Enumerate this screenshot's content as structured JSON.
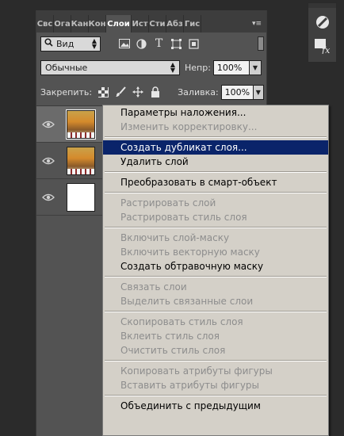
{
  "panel": {
    "tabs": [
      {
        "label": "Свс",
        "active": false
      },
      {
        "label": "Ога",
        "active": false
      },
      {
        "label": "Кан",
        "active": false
      },
      {
        "label": "Кон",
        "active": false
      },
      {
        "label": "Слои",
        "active": true
      },
      {
        "label": "Ист",
        "active": false
      },
      {
        "label": "Сти",
        "active": false
      },
      {
        "label": "Абз",
        "active": false
      },
      {
        "label": "Гис",
        "active": false
      }
    ],
    "tab_menu_glyph": "▾≡",
    "filter": {
      "kind_label": "Вид",
      "icons": [
        "image-filter-icon",
        "adjustment-filter-icon",
        "type-filter-icon",
        "shape-filter-icon",
        "smart-object-filter-icon"
      ]
    },
    "blend": {
      "mode": "Обычные",
      "opacity_label": "Непр:",
      "opacity_value": "100%"
    },
    "lock": {
      "label": "Закрепить:",
      "fill_label": "Заливка:",
      "fill_value": "100%"
    },
    "layers": [
      {
        "thumb": "photo",
        "selected": true
      },
      {
        "thumb": "photo",
        "selected": false
      },
      {
        "thumb": "white",
        "selected": false
      }
    ]
  },
  "dock": {
    "icons": [
      "color-wheel-icon",
      "fx-styles-icon"
    ]
  },
  "context_menu": {
    "items": [
      {
        "label": "Параметры наложения...",
        "enabled": true
      },
      {
        "label": "Изменить корректировку...",
        "enabled": false
      },
      {
        "separator": true
      },
      {
        "label": "Создать дубликат слоя...",
        "enabled": true,
        "highlight": true
      },
      {
        "label": "Удалить слой",
        "enabled": true
      },
      {
        "separator": true
      },
      {
        "label": "Преобразовать в смарт-объект",
        "enabled": true
      },
      {
        "separator": true
      },
      {
        "label": "Растрировать слой",
        "enabled": false
      },
      {
        "label": "Растрировать стиль слоя",
        "enabled": false
      },
      {
        "separator": true
      },
      {
        "label": "Включить слой-маску",
        "enabled": false
      },
      {
        "label": "Включить векторную маску",
        "enabled": false
      },
      {
        "label": "Создать обтравочную маску",
        "enabled": true
      },
      {
        "separator": true
      },
      {
        "label": "Связать слои",
        "enabled": false
      },
      {
        "label": "Выделить связанные слои",
        "enabled": false
      },
      {
        "separator": true
      },
      {
        "label": "Скопировать стиль слоя",
        "enabled": false
      },
      {
        "label": "Вклеить стиль слоя",
        "enabled": false
      },
      {
        "label": "Очистить стиль слоя",
        "enabled": false
      },
      {
        "separator": true
      },
      {
        "label": "Копировать атрибуты фигуры",
        "enabled": false
      },
      {
        "label": "Вставить атрибуты фигуры",
        "enabled": false
      },
      {
        "separator": true
      },
      {
        "label": "Объединить с предыдущим",
        "enabled": true
      }
    ]
  },
  "colors": {
    "highlight": "#0a246a",
    "menu_bg": "#d4d0c8",
    "panel_bg": "#535353",
    "app_bg": "#2b2b2b"
  }
}
